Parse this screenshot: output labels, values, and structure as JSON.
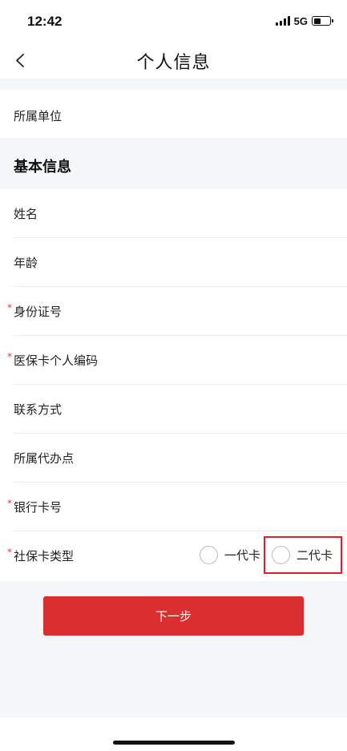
{
  "status_bar": {
    "time": "12:42",
    "network": "5G",
    "battery_level": 0.45
  },
  "nav": {
    "title": "个人信息",
    "back_icon": "chevron-left-icon"
  },
  "unit_row": {
    "label": "所属单位"
  },
  "section": {
    "title": "基本信息"
  },
  "form": {
    "name": {
      "label": "姓名",
      "required": false,
      "value": ""
    },
    "age": {
      "label": "年龄",
      "required": false,
      "value": ""
    },
    "id_number": {
      "label": "身份证号",
      "required": true,
      "value": ""
    },
    "medical_code": {
      "label": "医保卡个人编码",
      "required": true,
      "value": ""
    },
    "contact": {
      "label": "联系方式",
      "required": false,
      "value": ""
    },
    "agency": {
      "label": "所属代办点",
      "required": false,
      "value": ""
    },
    "bank_card": {
      "label": "银行卡号",
      "required": true,
      "value": ""
    },
    "card_type": {
      "label": "社保卡类型",
      "required": true,
      "options": [
        "一代卡",
        "二代卡"
      ],
      "selected": null
    },
    "required_mark": "*"
  },
  "actions": {
    "next_label": "下一步"
  },
  "colors": {
    "accent": "#d9302f",
    "required": "#e03b3b",
    "highlight": "#d8232a",
    "background": "#f5f6f8"
  }
}
